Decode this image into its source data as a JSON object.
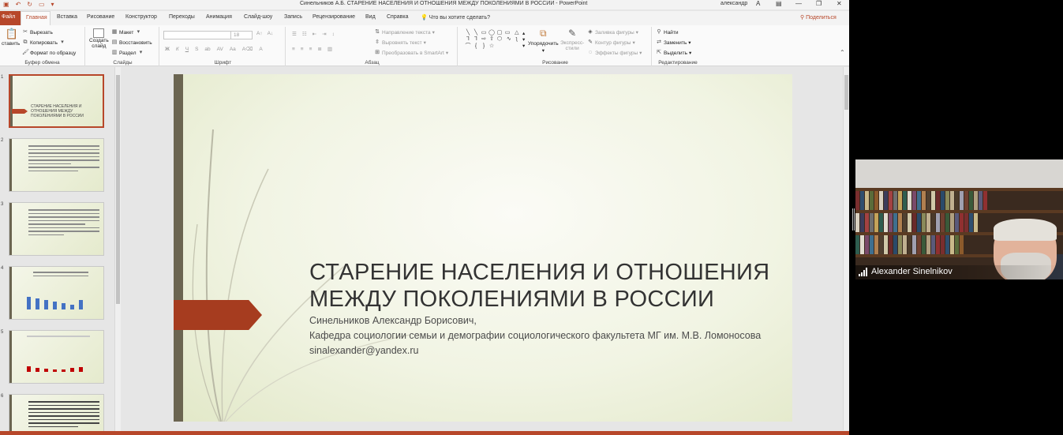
{
  "window": {
    "title": "Синельников А.Б. СТАРЕНИЕ НАСЕЛЕНИЯ И ОТНОШЕНИЯ МЕЖДУ ПОКОЛЕНИЯМИ В РОССИИ  -  PowerPoint",
    "user": "александр",
    "user_initial": "А"
  },
  "tabs": {
    "file": "Файл",
    "home": "Главная",
    "items": [
      "Вставка",
      "Рисование",
      "Конструктор",
      "Переходы",
      "Анимация",
      "Слайд-шоу",
      "Запись",
      "Рецензирование",
      "Вид",
      "Справка"
    ],
    "tell_me": "Что вы хотите сделать?",
    "share": "Поделиться"
  },
  "ribbon": {
    "clipboard": {
      "paste": "ставить",
      "cut": "Вырезать",
      "copy": "Копировать",
      "format_painter": "Формат по образцу",
      "label": "Буфер обмена"
    },
    "slides": {
      "new_slide_line1": "Создать",
      "new_slide_line2": "слайд",
      "layout": "Макет",
      "reset": "Восстановить",
      "section": "Раздел",
      "label": "Слайды"
    },
    "font": {
      "size": "18",
      "bold": "Ж",
      "italic": "К",
      "underline": "Ч",
      "strike": "S",
      "label": "Шрифт"
    },
    "paragraph": {
      "text_direction": "Направление текста",
      "align_text": "Выровнять текст",
      "smartart": "Преобразовать в SmartArt",
      "label": "Абзац"
    },
    "drawing": {
      "arrange": "Упорядочить",
      "quick_styles_line1": "Экспресс-",
      "quick_styles_line2": "стили",
      "shape_fill": "Заливка фигуры",
      "shape_outline": "Контур фигуры",
      "shape_effects": "Эффекты фигуры",
      "label": "Рисование"
    },
    "editing": {
      "find": "Найти",
      "replace": "Заменить",
      "select": "Выделить",
      "label": "Редактирование"
    }
  },
  "thumbnails": {
    "numbers": [
      "1",
      "2",
      "3",
      "4",
      "5",
      "6"
    ],
    "slide1_title": "СТАРЕНИЕ НАСЕЛЕНИЯ И ОТНОШЕНИЯ МЕЖДУ ПОКОЛЕНИЯМИ В РОССИИ"
  },
  "slide": {
    "title": "СТАРЕНИЕ НАСЕЛЕНИЯ И ОТНОШЕНИЯ МЕЖДУ ПОКОЛЕНИЯМИ В РОССИИ",
    "author": "Синельников Александр Борисович,",
    "department": "Кафедра социологии семьи и демографии социологического факультета МГ им. М.В. Ломоносова",
    "email": "sinalexander@yandex.ru"
  },
  "video": {
    "participant": "Alexander Sinelnikov"
  },
  "colors": {
    "accent": "#b7472a",
    "slide_arrow": "#a63c1f",
    "slide_stem": "#6b6551"
  }
}
